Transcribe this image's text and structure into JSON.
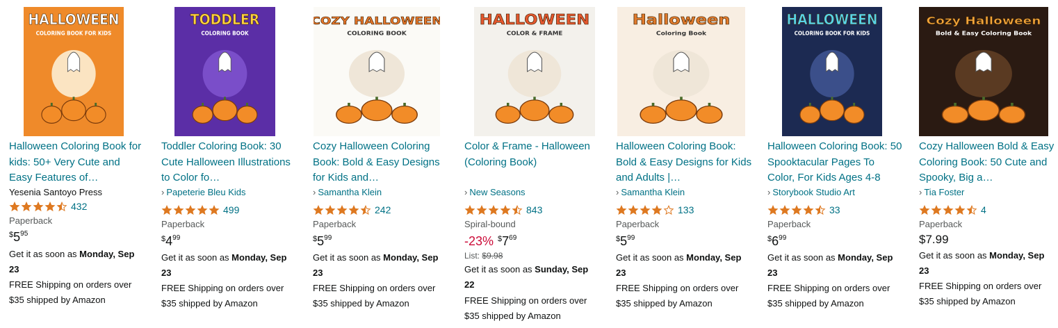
{
  "products": [
    {
      "cover": {
        "bg": "#ef8a2a",
        "accent": "#ffffff",
        "title_text": "HALLOWEEN",
        "sub_text": "COLORING BOOK FOR KIDS"
      },
      "title": "Halloween Coloring Book for kids: 50+ Very Cute and Easy Features of…",
      "author": "Yesenia Santoyo Press",
      "author_link": false,
      "rating": 4.5,
      "reviews": "432",
      "format": "Paperback",
      "price": {
        "symbol": "$",
        "whole": "5",
        "fraction": "95"
      },
      "delivery_prefix": "Get it as soon as ",
      "delivery_date": "Monday, Sep 23",
      "shipping": "FREE Shipping on orders over $35 shipped by Amazon"
    },
    {
      "cover": {
        "bg": "#5b2ea6",
        "accent": "#ffd23f",
        "title_text": "TODDLER",
        "sub_text": "COLORING BOOK"
      },
      "title": "Toddler Coloring Book: 30 Cute Halloween Illustrations to Color fo…",
      "author": "Papeterie Bleu Kids",
      "author_link": true,
      "rating": 5,
      "reviews": "499",
      "format": "Paperback",
      "price": {
        "symbol": "$",
        "whole": "4",
        "fraction": "99"
      },
      "delivery_prefix": "Get it as soon as ",
      "delivery_date": "Monday, Sep 23",
      "shipping": "FREE Shipping on orders over $35 shipped by Amazon"
    },
    {
      "cover": {
        "bg": "#fbfaf6",
        "accent": "#e8762a",
        "title_text": "COZY HALLOWEEN",
        "sub_text": "COLORING BOOK"
      },
      "title": "Cozy Halloween Coloring Book: Bold & Easy Designs for Kids and…",
      "author": "Samantha Klein",
      "author_link": true,
      "rating": 4.5,
      "reviews": "242",
      "format": "Paperback",
      "price": {
        "symbol": "$",
        "whole": "5",
        "fraction": "99"
      },
      "delivery_prefix": "Get it as soon as ",
      "delivery_date": "Monday, Sep 23",
      "shipping": "FREE Shipping on orders over $35 shipped by Amazon"
    },
    {
      "cover": {
        "bg": "#f3f1ec",
        "accent": "#e4572e",
        "title_text": "HALLOWEEN",
        "sub_text": "COLOR & FRAME"
      },
      "title": "Color & Frame - Halloween (Coloring Book)",
      "author": "New Seasons",
      "author_link": true,
      "rating": 4.5,
      "reviews": "843",
      "format": "Spiral-bound",
      "discount": "-23%",
      "price": {
        "symbol": "$",
        "whole": "7",
        "fraction": "69"
      },
      "list_label": "List: ",
      "list_price": "$9.98",
      "delivery_prefix": "Get it as soon as ",
      "delivery_date": "Sunday, Sep 22",
      "shipping": "FREE Shipping on orders over $35 shipped by Amazon"
    },
    {
      "cover": {
        "bg": "#f8eee2",
        "accent": "#e07a2c",
        "title_text": "Halloween",
        "sub_text": "Coloring Book"
      },
      "title": "Halloween Coloring Book: Bold & Easy Designs for Kids and Adults |…",
      "author": "Samantha Klein",
      "author_link": true,
      "rating": 4,
      "reviews": "133",
      "format": "Paperback",
      "price": {
        "symbol": "$",
        "whole": "5",
        "fraction": "99"
      },
      "delivery_prefix": "Get it as soon as ",
      "delivery_date": "Monday, Sep 23",
      "shipping": "FREE Shipping on orders over $35 shipped by Amazon"
    },
    {
      "cover": {
        "bg": "#1c2a52",
        "accent": "#57d3e8",
        "title_text": "HALLOWEEN",
        "sub_text": "COLORING BOOK FOR KIDS"
      },
      "title": "Halloween Coloring Book: 50 Spooktacular Pages To Color, For Kids Ages 4-8",
      "author": "Storybook Studio Art",
      "author_link": true,
      "rating": 4.5,
      "reviews": "33",
      "format": "Paperback",
      "price": {
        "symbol": "$",
        "whole": "6",
        "fraction": "99"
      },
      "delivery_prefix": "Get it as soon as ",
      "delivery_date": "Monday, Sep 23",
      "shipping": "FREE Shipping on orders over $35 shipped by Amazon"
    },
    {
      "cover": {
        "bg": "#2a1a12",
        "accent": "#f2a53b",
        "title_text": "Cozy Halloween",
        "sub_text": "Bold & Easy Coloring Book"
      },
      "title": "Cozy Halloween Bold & Easy Coloring Book: 50 Cute and Spooky, Big a…",
      "author": "Tia Foster",
      "author_link": true,
      "rating": 4.5,
      "reviews": "4",
      "format": "Paperback",
      "price_full": "$7.99",
      "delivery_prefix": "Get it as soon as ",
      "delivery_date": "Monday, Sep 23",
      "shipping": "FREE Shipping on orders over $35 shipped by Amazon"
    }
  ],
  "colors": {
    "link": "#007185",
    "star": "#de7921",
    "star_empty": "#ffffff",
    "discount": "#cc0c39",
    "muted": "#565959"
  },
  "icons": {
    "star": "star-icon",
    "half_star": "half-star-icon",
    "empty_star": "empty-star-icon",
    "chevron": "chevron-right-icon"
  }
}
